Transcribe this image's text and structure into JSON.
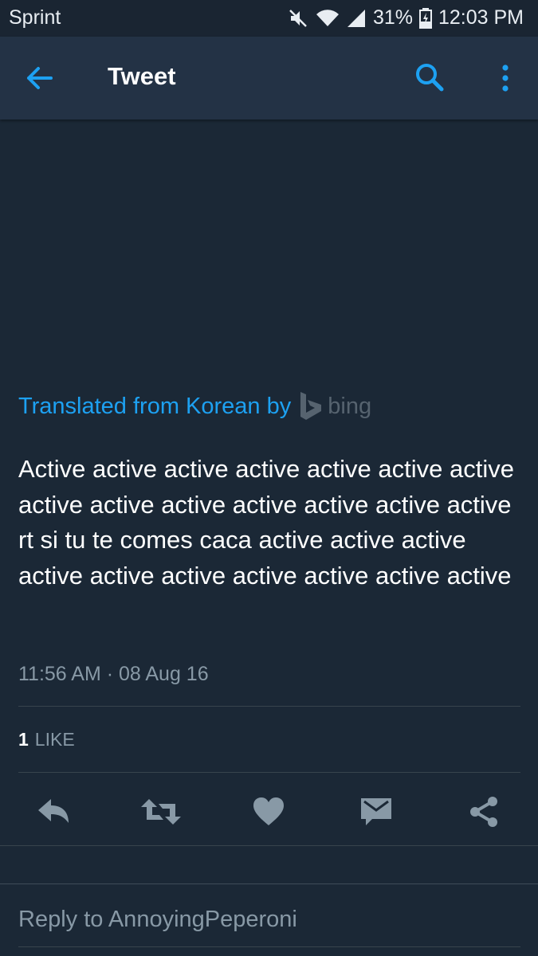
{
  "status_bar": {
    "carrier": "Sprint",
    "battery": "31%",
    "time": "12:03 PM",
    "icons": [
      "mute-icon",
      "wifi-icon",
      "signal-icon",
      "battery-icon"
    ]
  },
  "app_bar": {
    "title": "Tweet",
    "icons": [
      "back-arrow-icon",
      "search-icon",
      "more-vert-icon"
    ]
  },
  "tweet": {
    "translated_label": "Translated from Korean by",
    "translator_name": "bing",
    "text": "Active active active active active active active active active active active active active active rt si tu te comes caca active active active active active active active active active active",
    "timestamp": "11:56 AM · 08 Aug 16",
    "like_count": "1",
    "like_label": "LIKE"
  },
  "actions": [
    "reply-icon",
    "retweet-icon",
    "like-heart-icon",
    "direct-message-icon",
    "share-icon"
  ],
  "reply": {
    "placeholder": "Reply to AnnoyingPeperoni"
  },
  "colors": {
    "background": "#1b2836",
    "app_bar": "#233245",
    "accent": "#1da1f2",
    "secondary_text": "#8899a6",
    "icon": "#8899a6"
  }
}
